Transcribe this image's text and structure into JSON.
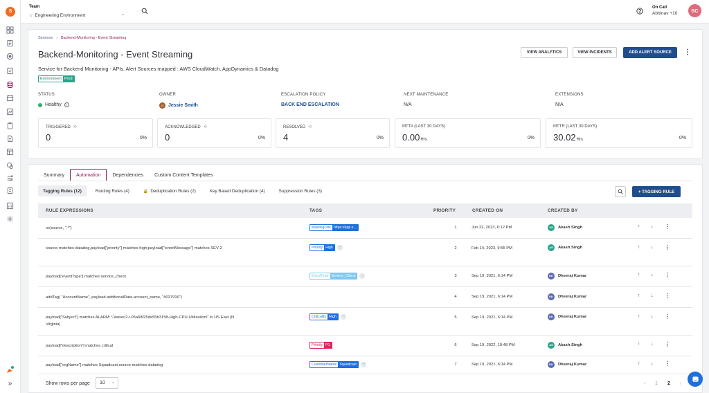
{
  "sidebar": {
    "logo_letter": "S",
    "expand_glyph": "»"
  },
  "topbar": {
    "team_label": "Team",
    "team_value": "Engineering Environment",
    "oncall_label": "On Call",
    "oncall_value": "Abhinav +10",
    "user_initials": "SC"
  },
  "breadcrumb": {
    "root": "Services",
    "current": "Backend-Monitoring - Event Streaming"
  },
  "service": {
    "title": "Backend-Monitoring - Event Streaming",
    "description": "Service for Backend Monitoring - APIs. Alert Sources mapped : AWS CloudWatch, AppDynamics & Datadog",
    "env_key": "Environment",
    "env_value": "Prod"
  },
  "actions": {
    "view_analytics": "VIEW ANALYTICS",
    "view_incidents": "VIEW INCIDENTS",
    "add_alert_source": "ADD ALERT SOURCE"
  },
  "meta": {
    "status_label": "STATUS",
    "status_value": "Healthy",
    "owner_label": "OWNER",
    "owner_initials": "JS",
    "owner_value": "Jessie Smith",
    "escalation_label": "ESCALATION POLICY",
    "escalation_value": "BACK END ESCALATION",
    "maintenance_label": "NEXT MAINTENANCE",
    "maintenance_value": "N/A",
    "extensions_label": "EXTENSIONS",
    "extensions_value": "N/A"
  },
  "stats": [
    {
      "label": "TRIGGERED",
      "value": "0",
      "unit": "",
      "pct": "0%"
    },
    {
      "label": "ACKNOWLEDGED",
      "value": "0",
      "unit": "",
      "pct": "0%"
    },
    {
      "label": "RESOLVED",
      "value": "4",
      "unit": "",
      "pct": "0%"
    },
    {
      "label": "MTTA (LAST 30 DAYS)",
      "value": "0.00",
      "unit": "Hrs",
      "pct": "0%"
    },
    {
      "label": "MTTR (LAST 30 DAYS)",
      "value": "30.02",
      "unit": "Hrs",
      "pct": "0%"
    }
  ],
  "tabs": [
    "Summary",
    "Automation",
    "Dependencies",
    "Custom Content Templates"
  ],
  "subtabs": [
    "Tagging Rules (12)",
    "Routing Rules (4)",
    "Deduplication Rules (2)",
    "Key Based Deduplication (4)",
    "Suppression Rules (3)"
  ],
  "add_rule": "+ TAGGING RULE",
  "columns": {
    "expr": "RULE EXPRESSIONS",
    "tags": "TAGS",
    "priority": "PRIORITY",
    "created_on": "CREATED ON",
    "created_by": "CREATED BY"
  },
  "rows": [
    {
      "expr": "re(source, \".*\")",
      "tag_key": "MeetingLink",
      "tag_val": "https://app.s...",
      "more": "",
      "priority": "1",
      "created": "Jun 22, 2023, 6:12 PM",
      "by_initials": "AS",
      "by": "Akash Singh"
    },
    {
      "expr": "source matches datadog,payload[\"priority\"] matches high,payload[\"eventMessage\"] matches SEV-2",
      "tag_key": "Priority",
      "tag_val": "High",
      "more": "···",
      "priority": "2",
      "created": "Feb 14, 2023, 9:55 PM",
      "by_initials": "AS",
      "by": "Akash Singh"
    },
    {
      "expr": "payload[\"eventType\"] matches service_check",
      "tag_key": "EventType",
      "tag_val": "Service_Check",
      "more": "···",
      "priority": "3",
      "created": "Sep 19, 2021, 6:14 PM",
      "by_initials": "DK",
      "by": "Dheeraj Kumar"
    },
    {
      "expr": "addTag( \"AccountName\", payload.additionalData.account_name, \"#037916\")",
      "tag_key": "",
      "tag_val": "",
      "more": "",
      "priority": "4",
      "created": "Sep 19, 2021, 6:14 PM",
      "by_initials": "DK",
      "by": "Dheeraj Kumar"
    },
    {
      "expr": "payload[\"Subject\"] matches ALARM: \\\"awsec2-i-05a68f25de55b3158-High-CPU-Utilization\\\" in US East (N. Virginia)",
      "tag_key": "Criticality",
      "tag_val": "High",
      "more": "···",
      "priority": "5",
      "created": "Sep 19, 2021, 6:14 PM",
      "by_initials": "DK",
      "by": "Dheeraj Kumar"
    },
    {
      "expr": "payload[\"description\"] matches critical",
      "tag_key": "Priority",
      "tag_val": "P1",
      "more": "",
      "priority": "6",
      "created": "Sep 19, 2022, 10:48 PM",
      "by_initials": "AS",
      "by": "Akash Singh"
    },
    {
      "expr": "payload[\"orgName\"] matches Squadcast,source matches datadog",
      "tag_key": "CustomerName",
      "tag_val": "Squadcast",
      "more": "···",
      "priority": "7",
      "created": "Sep 19, 2021, 6:14 PM",
      "by_initials": "DK",
      "by": "Dheeraj Kumar"
    }
  ],
  "footer": {
    "rows_label": "Show rows per page",
    "rows_value": "10",
    "prev": "‹",
    "page1": "1",
    "page2": "2",
    "next": "›"
  },
  "colors": {
    "brand": "#8a1c5c",
    "primary_button": "#1f4d8e",
    "healthy": "#2fb36a"
  }
}
